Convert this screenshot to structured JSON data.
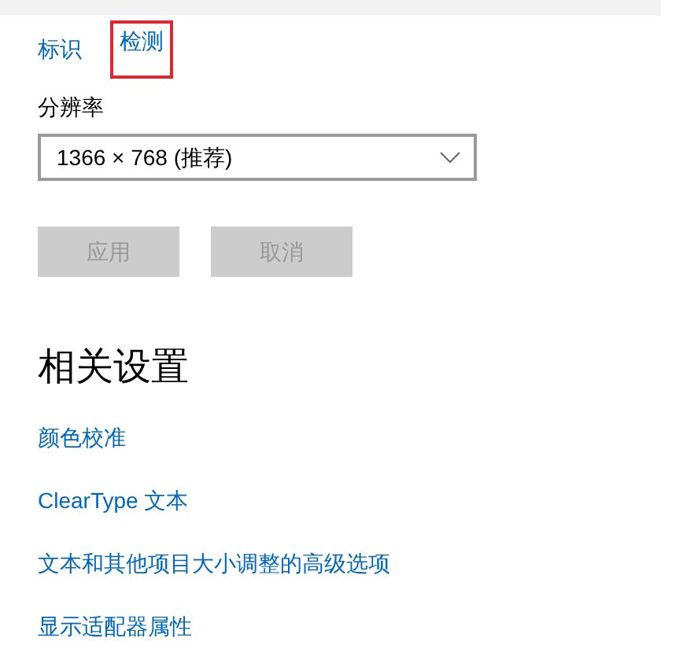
{
  "top_links": [
    {
      "label": "标识",
      "highlighted": false
    },
    {
      "label": "检测",
      "highlighted": true
    }
  ],
  "resolution": {
    "label": "分辨率",
    "value": "1366 × 768 (推荐)"
  },
  "buttons": [
    {
      "label": "应用",
      "disabled": true
    },
    {
      "label": "取消",
      "disabled": true
    }
  ],
  "related": {
    "heading": "相关设置",
    "links": [
      "颜色校准",
      "ClearType 文本",
      "文本和其他项目大小调整的高级选项",
      "显示适配器属性"
    ]
  }
}
